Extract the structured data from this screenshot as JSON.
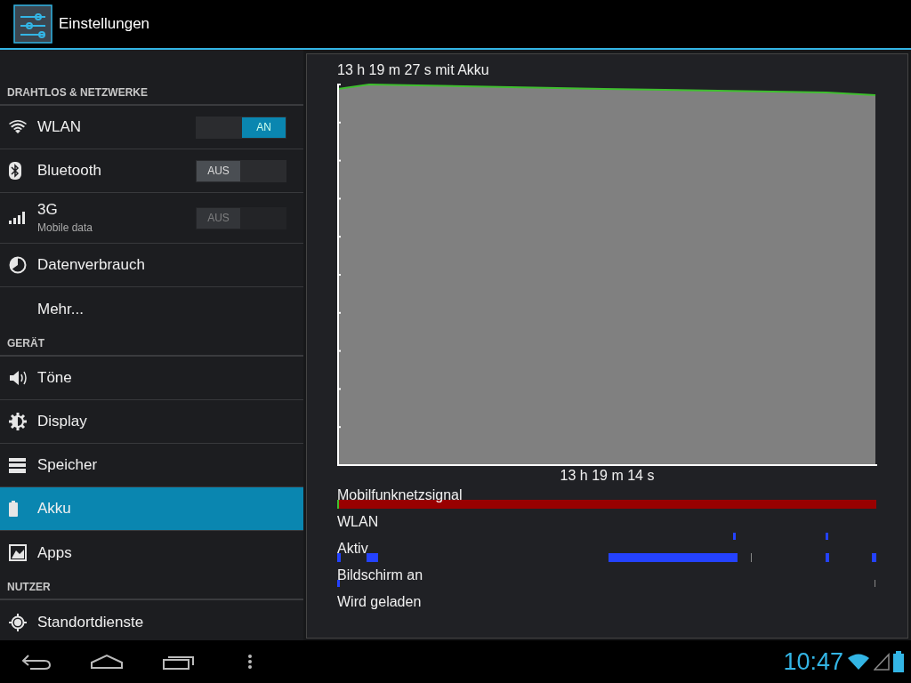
{
  "action_bar": {
    "title": "Einstellungen"
  },
  "sidebar": {
    "sections": [
      {
        "header": "DRAHTLOS & NETZWERKE",
        "items": [
          {
            "label": "WLAN",
            "selected": false,
            "toggle": {
              "label": "AN",
              "on": true,
              "disabled": false
            }
          },
          {
            "label": "Bluetooth",
            "selected": false,
            "toggle": {
              "label": "AUS",
              "on": false,
              "disabled": false
            }
          },
          {
            "label": "3G",
            "subtitle": "Mobile data",
            "selected": false,
            "toggle": {
              "label": "AUS",
              "on": false,
              "disabled": true
            }
          },
          {
            "label": "Datenverbrauch",
            "selected": false
          },
          {
            "label": "Mehr...",
            "selected": false
          }
        ]
      },
      {
        "header": "GERÄT",
        "items": [
          {
            "label": "Töne",
            "selected": false
          },
          {
            "label": "Display",
            "selected": false
          },
          {
            "label": "Speicher",
            "selected": false
          },
          {
            "label": "Akku",
            "selected": true
          },
          {
            "label": "Apps",
            "selected": false
          }
        ]
      },
      {
        "header": "NUTZER",
        "items": [
          {
            "label": "Standortdienste",
            "selected": false
          }
        ]
      }
    ]
  },
  "battery_history": {
    "duration": "13 h 19 m 27 s mit Akku",
    "time_axis_label": "13 h 19 m 14 s",
    "timelines": [
      "Mobilfunknetzsignal",
      "WLAN",
      "Aktiv",
      "Bildschirm an",
      "Wird geladen"
    ]
  },
  "status_bar": {
    "time": "10:47"
  }
}
